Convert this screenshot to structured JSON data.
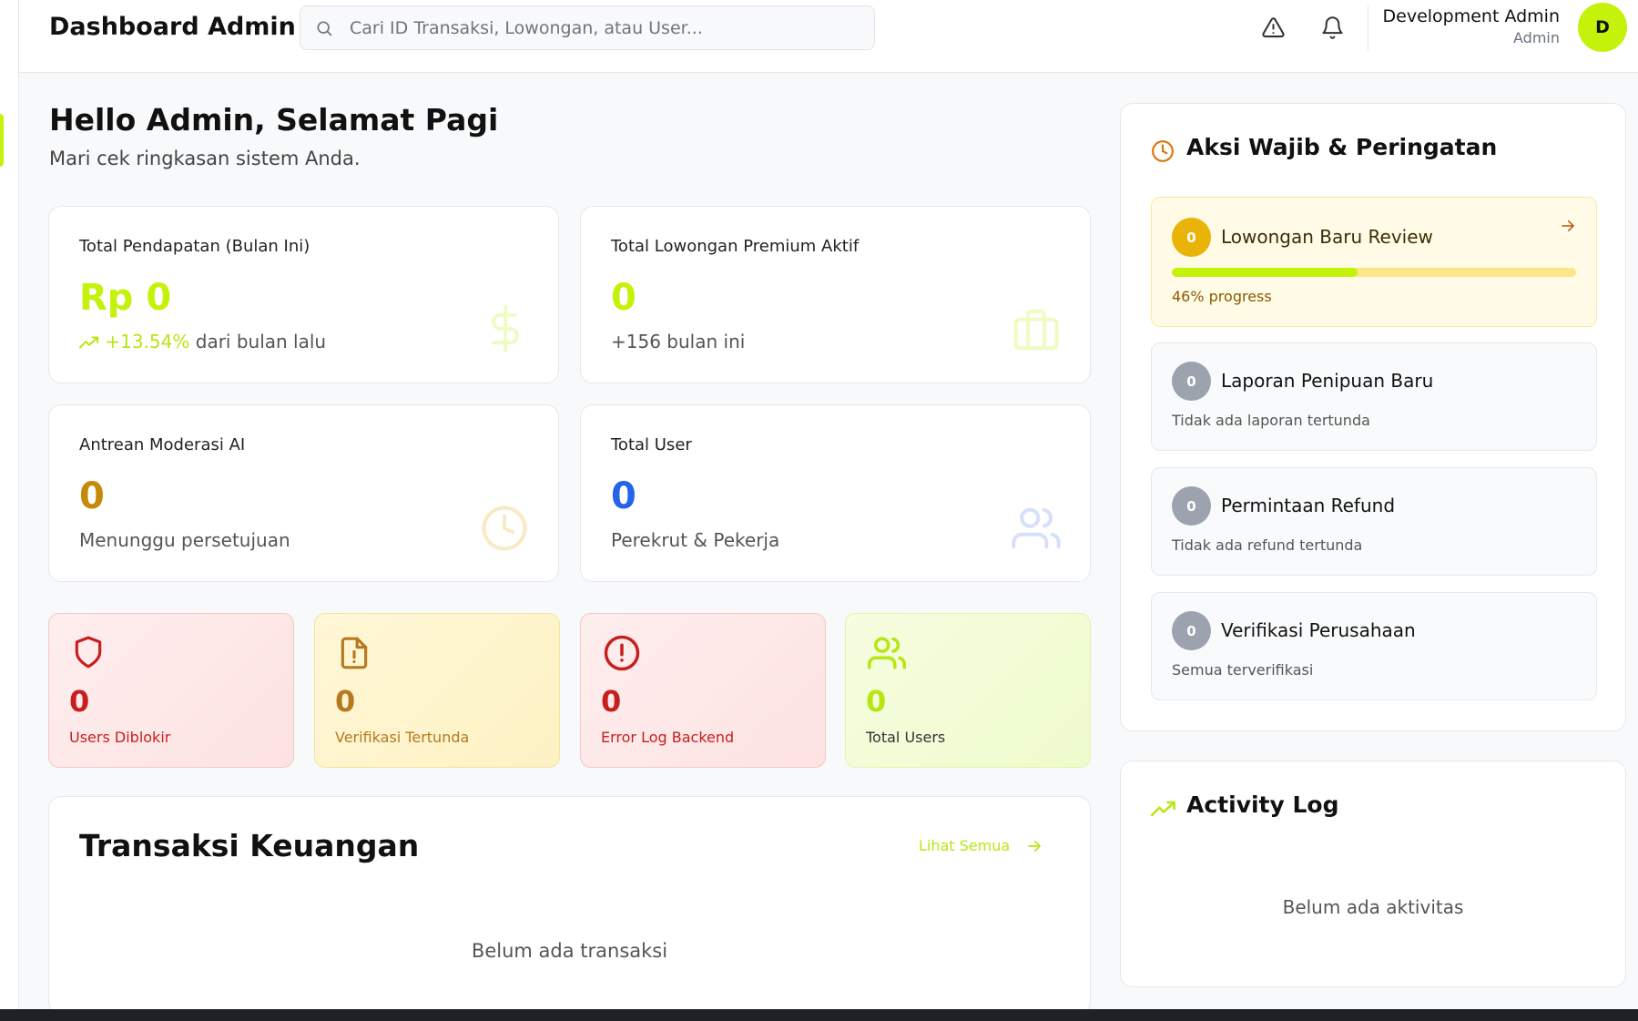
{
  "header": {
    "title": "Dashboard Admin",
    "search_placeholder": "Cari ID Transaksi, Lowongan, atau User...",
    "user_name": "Development Admin",
    "user_role": "Admin",
    "avatar_initial": "D",
    "icons": [
      "alert-triangle-icon",
      "bell-icon"
    ]
  },
  "greeting": {
    "title": "Hello Admin, Selamat Pagi",
    "subtitle": "Mari cek ringkasan sistem Anda."
  },
  "stats": [
    {
      "label": "Total Pendapatan (Bulan Ini)",
      "value": "Rp 0",
      "trend": "+13.54%",
      "sub": "dari bulan lalu",
      "icon": "dollar-icon",
      "color": "#c5f20a"
    },
    {
      "label": "Total Lowongan Premium Aktif",
      "value": "0",
      "sub": "+156 bulan ini",
      "icon": "briefcase-icon",
      "color": "#c5f20a"
    },
    {
      "label": "Antrean Moderasi AI",
      "value": "0",
      "sub": "Menunggu persetujuan",
      "icon": "clock-icon",
      "color": "#c58a0a"
    },
    {
      "label": "Total User",
      "value": "0",
      "sub": "Perekrut & Pekerja",
      "icon": "users-icon",
      "color": "#2563eb"
    }
  ],
  "mini_cards": [
    {
      "value": "0",
      "label": "Users Diblokir",
      "icon": "shield-icon",
      "color": "#c81e1e"
    },
    {
      "value": "0",
      "label": "Verifikasi Tertunda",
      "icon": "file-alert-icon",
      "color": "#b7791f"
    },
    {
      "value": "0",
      "label": "Error Log Backend",
      "icon": "alert-circle-icon",
      "color": "#c81e1e"
    },
    {
      "value": "0",
      "label": "Total Users",
      "icon": "users-icon",
      "color": "#b8e612"
    }
  ],
  "transactions": {
    "title": "Transaksi Keuangan",
    "link": "Lihat Semua",
    "empty": "Belum ada transaksi"
  },
  "aksi": {
    "title": "Aksi Wajib & Peringatan",
    "items": [
      {
        "count": "0",
        "name": "Lowongan Baru Review",
        "progress": 46,
        "progress_text": "46% progress"
      },
      {
        "count": "0",
        "name": "Laporan Penipuan Baru",
        "desc": "Tidak ada laporan tertunda"
      },
      {
        "count": "0",
        "name": "Permintaan Refund",
        "desc": "Tidak ada refund tertunda"
      },
      {
        "count": "0",
        "name": "Verifikasi Perusahaan",
        "desc": "Semua terverifikasi"
      }
    ]
  },
  "activity": {
    "title": "Activity Log",
    "empty": "Belum ada aktivitas"
  },
  "colors": {
    "accent": "#c5f20a",
    "warning": "#eab308",
    "danger": "#c81e1e",
    "blue": "#2563eb"
  }
}
